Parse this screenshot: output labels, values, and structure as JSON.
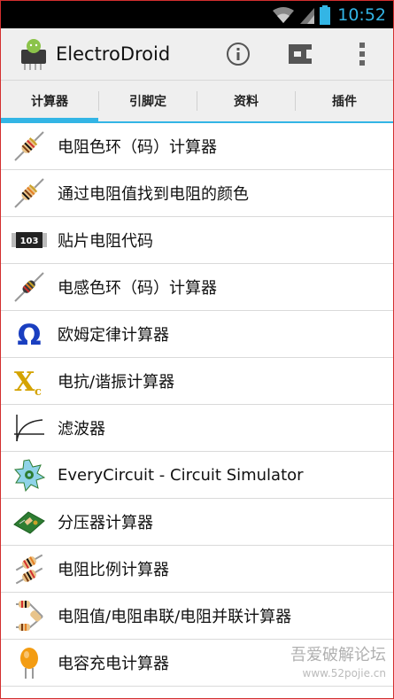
{
  "status_bar": {
    "time": "10:52"
  },
  "action_bar": {
    "title": "ElectroDroid",
    "info_icon": "info-icon",
    "plugin_icon": "plugin-connector-icon",
    "overflow_icon": "overflow-menu-icon"
  },
  "tabs": [
    {
      "label": "计算器",
      "active": true
    },
    {
      "label": "引脚定",
      "active": false
    },
    {
      "label": "资料",
      "active": false
    },
    {
      "label": "插件",
      "active": false
    }
  ],
  "list": [
    {
      "label": "电阻色环（码）计算器",
      "icon": "resistor-icon"
    },
    {
      "label": "通过电阻值找到电阻的颜色",
      "icon": "resistor-icon"
    },
    {
      "label": "贴片电阻代码",
      "icon": "smd-resistor-icon",
      "icon_text": "103"
    },
    {
      "label": "电感色环（码）计算器",
      "icon": "inductor-icon"
    },
    {
      "label": "欧姆定律计算器",
      "icon": "omega-icon",
      "icon_text": "Ω"
    },
    {
      "label": "电抗/谐振计算器",
      "icon": "reactance-icon",
      "icon_text": "X"
    },
    {
      "label": "滤波器",
      "icon": "filter-curve-icon"
    },
    {
      "label": "EveryCircuit - Circuit Simulator",
      "icon": "everycircuit-icon"
    },
    {
      "label": "分压器计算器",
      "icon": "circuit-board-icon"
    },
    {
      "label": "电阻比例计算器",
      "icon": "resistor-ratio-icon"
    },
    {
      "label": "电阻值/电阻串联/电阻并联计算器",
      "icon": "resistor-network-icon"
    },
    {
      "label": "电容充电计算器",
      "icon": "capacitor-icon"
    }
  ],
  "watermark": {
    "text": "吾爱破解论坛",
    "url": "www.52pojie.cn"
  },
  "colors": {
    "accent": "#33b5e5",
    "status_bar": "#000000",
    "action_bar": "#efefef"
  }
}
